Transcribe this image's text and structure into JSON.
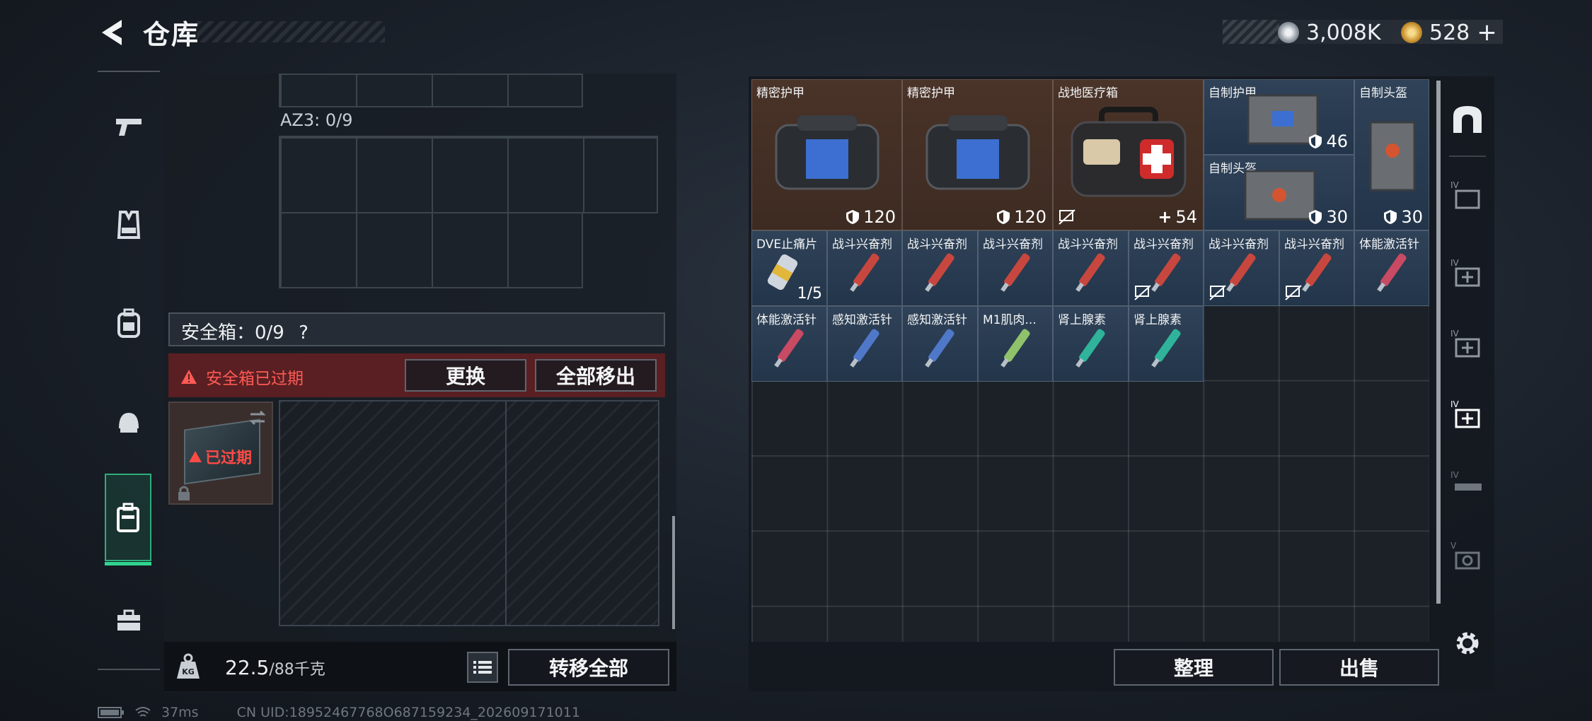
{
  "header": {
    "title": "仓库",
    "currencies": [
      {
        "icon": "silver-coin-icon",
        "value": "3,008K",
        "color": "#cfd4d9"
      },
      {
        "icon": "gold-coin-icon",
        "value": "528",
        "color": "#d5a33a"
      }
    ],
    "add_symbol": "+"
  },
  "side_nav": {
    "items": [
      {
        "icon": "weapon-icon",
        "active": false
      },
      {
        "icon": "vest-icon",
        "active": false
      },
      {
        "icon": "backpack-icon",
        "active": false
      },
      {
        "icon": "helmet-icon",
        "active": false
      },
      {
        "icon": "safebox-icon",
        "active": true
      },
      {
        "icon": "briefcase-icon",
        "active": false
      }
    ]
  },
  "container": {
    "az_label": "AZ3: 0/9",
    "safebox_label": "安全箱：0/9",
    "help_symbol": "?",
    "alert_text": "安全箱已过期",
    "replace_button": "更换",
    "move_all_out_button": "全部移出",
    "expired_label": "已过期"
  },
  "weight": {
    "current": "22.5",
    "max": "/88千克",
    "transfer_all_button": "转移全部"
  },
  "stash": {
    "items": [
      {
        "name": "精密护甲",
        "value": "120",
        "value_icon": "armor-icon",
        "color": "brown"
      },
      {
        "name": "精密护甲",
        "value": "120",
        "value_icon": "armor-icon",
        "color": "brown"
      },
      {
        "name": "战地医疗箱",
        "value": "54",
        "value_icon": "plus-icon",
        "color": "brown",
        "no_insurance": true
      },
      {
        "name": "自制护甲",
        "value": "46",
        "value_icon": "armor-icon",
        "color": "blue"
      },
      {
        "name": "自制头盔",
        "value": "30",
        "value_icon": "armor-icon",
        "color": "blue"
      },
      {
        "name": "自制头盔",
        "value": "30",
        "value_icon": "armor-icon",
        "color": "blue"
      },
      {
        "name": "DVE止痛片",
        "count": "1/5",
        "color": "blue"
      },
      {
        "name": "战斗兴奋剂",
        "color": "blue"
      },
      {
        "name": "战斗兴奋剂",
        "color": "blue"
      },
      {
        "name": "战斗兴奋剂",
        "color": "blue"
      },
      {
        "name": "战斗兴奋剂",
        "color": "blue"
      },
      {
        "name": "战斗兴奋剂",
        "color": "blue",
        "no_insurance": true
      },
      {
        "name": "战斗兴奋剂",
        "color": "blue",
        "no_insurance": true
      },
      {
        "name": "战斗兴奋剂",
        "color": "blue",
        "no_insurance": true
      },
      {
        "name": "体能激活针",
        "color": "blue"
      },
      {
        "name": "体能激活针",
        "color": "blue"
      },
      {
        "name": "感知激活针",
        "color": "blue"
      },
      {
        "name": "感知激活针",
        "color": "blue"
      },
      {
        "name": "M1肌肉...",
        "color": "blue"
      },
      {
        "name": "肾上腺素",
        "color": "blue"
      },
      {
        "name": "肾上腺素",
        "color": "blue"
      }
    ],
    "organize_button": "整理",
    "sell_button": "出售",
    "rail_labels": [
      "IV",
      "IV",
      "IV",
      "IV",
      "IV",
      "V"
    ]
  },
  "status": {
    "ping": "37ms",
    "uid": "CN UID:18952467768O687159234_202609171011"
  }
}
